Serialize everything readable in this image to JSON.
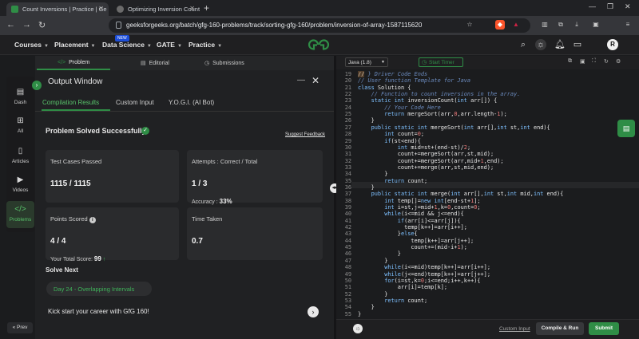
{
  "browser": {
    "tabs": [
      {
        "title": "Count Inversions | Practice | Ge",
        "active": true
      },
      {
        "title": "Optimizing Inversion Count",
        "active": false
      }
    ],
    "new_tab": "+",
    "url": "geeksforgeeks.org/batch/gfg-160-problems/track/sorting-gfg-160/problem/inversion-of-array-1587115620"
  },
  "header": {
    "nav": [
      {
        "label": "Courses"
      },
      {
        "label": "Placement"
      },
      {
        "label": "Data Science",
        "badge": "NEW"
      },
      {
        "label": "GATE"
      },
      {
        "label": "Practice"
      }
    ],
    "avatar_letter": "R"
  },
  "rail": {
    "items": [
      {
        "label": "Dash",
        "icon": "grid-icon"
      },
      {
        "label": "All",
        "icon": "apps-icon"
      },
      {
        "label": "Articles",
        "icon": "book-icon"
      },
      {
        "label": "Videos",
        "icon": "video-icon"
      },
      {
        "label": "Problems",
        "icon": "code-icon",
        "active": true
      }
    ],
    "prev_label": "« Prev"
  },
  "problem_tabs": [
    {
      "label": "Problem",
      "icon": "</>"
    },
    {
      "label": "Editorial",
      "icon": "▤"
    },
    {
      "label": "Submissions",
      "icon": "◷"
    }
  ],
  "output": {
    "title": "Output Window",
    "tabs": [
      "Compilation Results",
      "Custom Input",
      "Y.O.G.I. (AI Bot)"
    ],
    "status": "Problem Solved Successfully",
    "feedback": "Suggest Feedback",
    "test_cases_label": "Test Cases Passed",
    "test_cases_value": "1115 / 1115",
    "attempts_label": "Attempts : Correct / Total",
    "attempts_value": "1 / 3",
    "accuracy_label": "Accuracy :",
    "accuracy_value": "33%",
    "points_label": "Points Scored",
    "points_value": "4 / 4",
    "total_score_label": "Your Total Score:",
    "total_score_value": "99",
    "time_label": "Time Taken",
    "time_value": "0.7",
    "solve_next": "Solve Next",
    "next_problem": "Day 24 - Overlapping Intervals",
    "kick": "Kick start your career with GfG 160!"
  },
  "editor": {
    "language": "Java (1.8)",
    "timer": "Start Timer",
    "custom_input": "Custom Input",
    "compile": "Compile & Run",
    "submit": "Submit",
    "lines": [
      {
        "n": "19",
        "code": "<span class=\"hl\">//</span><span class=\"cm\"> } Driver Code Ends</span>"
      },
      {
        "n": "20",
        "code": "<span class=\"cm\">// User function Template for Java</span>"
      },
      {
        "n": "21",
        "code": "<span class=\"kw\">class</span> Solution {"
      },
      {
        "n": "22",
        "code": "    <span class=\"cm\">// Function to count inversions in the array.</span>"
      },
      {
        "n": "23",
        "code": "    <span class=\"kw\">static int</span> inversionCount(<span class=\"ty\">int</span> arr[]) {"
      },
      {
        "n": "24",
        "code": "        <span class=\"cm\">// Your Code Here</span>"
      },
      {
        "n": "25",
        "code": "        <span class=\"kw\">return</span> mergeSort(arr,<span class=\"nm\">0</span>,arr.length-<span class=\"nm\">1</span>);"
      },
      {
        "n": "26",
        "code": "    }"
      },
      {
        "n": "27",
        "code": "    <span class=\"kw\">public static int</span> mergeSort(<span class=\"ty\">int</span> arr[],<span class=\"ty\">int</span> st,<span class=\"ty\">int</span> end){"
      },
      {
        "n": "28",
        "code": "        <span class=\"ty\">int</span> count=<span class=\"nm\">0</span>;"
      },
      {
        "n": "29",
        "code": "        <span class=\"kw\">if</span>(st&lt;end){"
      },
      {
        "n": "30",
        "code": "            <span class=\"ty\">int</span> mid=st+(end-st)/<span class=\"nm\">2</span>;"
      },
      {
        "n": "31",
        "code": "            count+=mergeSort(arr,st,mid);"
      },
      {
        "n": "32",
        "code": "            count+=mergeSort(arr,mid+<span class=\"nm\">1</span>,end);"
      },
      {
        "n": "33",
        "code": "            count+=merge(arr,st,mid,end);"
      },
      {
        "n": "34",
        "code": "        }"
      },
      {
        "n": "35",
        "code": "        <span class=\"kw\">return</span> count;"
      },
      {
        "n": "36",
        "code": "    }"
      },
      {
        "n": "37",
        "code": "    <span class=\"kw\">public static int</span> merge(<span class=\"ty\">int</span> arr[],<span class=\"ty\">int</span> st,<span class=\"ty\">int</span> mid,<span class=\"ty\">int</span> end){"
      },
      {
        "n": "38",
        "code": "        <span class=\"ty\">int</span> temp[]=<span class=\"kw\">new int</span>[end-st+<span class=\"nm\">1</span>];"
      },
      {
        "n": "39",
        "code": "        <span class=\"ty\">int</span> i=st,j=mid+<span class=\"nm\">1</span>,k=<span class=\"nm\">0</span>,count=<span class=\"nm\">0</span>;"
      },
      {
        "n": "40",
        "code": "        <span class=\"kw\">while</span>(i&lt;=mid &amp;&amp; j&lt;=end){"
      },
      {
        "n": "41",
        "code": "            <span class=\"kw\">if</span>(arr[i]&lt;=arr[j]){"
      },
      {
        "n": "42",
        "code": "              temp[k++]=arr[i++];"
      },
      {
        "n": "43",
        "code": "            }<span class=\"kw\">else</span>{"
      },
      {
        "n": "44",
        "code": "                temp[k++]=arr[j++];"
      },
      {
        "n": "45",
        "code": "                count+=(mid-i+<span class=\"nm\">1</span>);"
      },
      {
        "n": "46",
        "code": "            }"
      },
      {
        "n": "47",
        "code": "        }"
      },
      {
        "n": "48",
        "code": "        <span class=\"kw\">while</span>(i&lt;=mid)temp[k++]=arr[i++];"
      },
      {
        "n": "49",
        "code": "        <span class=\"kw\">while</span>(j&lt;=end)temp[k++]=arr[j++];"
      },
      {
        "n": "50",
        "code": "        <span class=\"kw\">for</span>(i=st,k=<span class=\"nm\">0</span>;i&lt;=end;i++,k++){"
      },
      {
        "n": "51",
        "code": "            arr[i]=temp[k];"
      },
      {
        "n": "52",
        "code": "        }"
      },
      {
        "n": "53",
        "code": "        <span class=\"kw\">return</span> count;"
      },
      {
        "n": "54",
        "code": "    }"
      },
      {
        "n": "55",
        "code": "}"
      }
    ]
  },
  "colors": {
    "brand_green": "#2f8d46",
    "panel_bg": "#202123",
    "card_bg": "#2a2b2d"
  }
}
